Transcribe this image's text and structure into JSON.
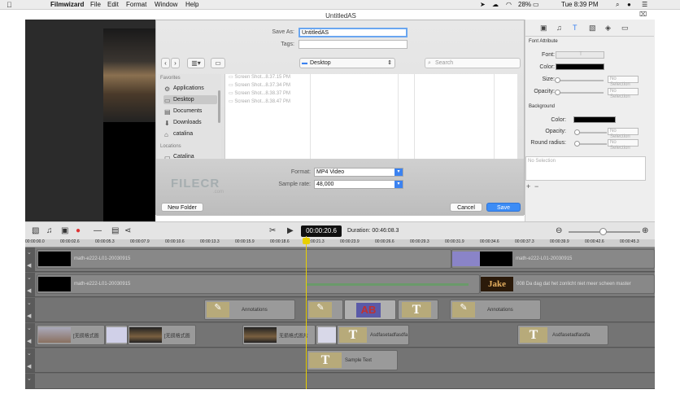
{
  "menubar": {
    "app": "Filmwizard",
    "items": [
      "File",
      "Edit",
      "Format",
      "Window",
      "Help"
    ],
    "battery": "28%",
    "clock": "Tue 8:39 PM"
  },
  "dialog": {
    "title": "UntitledAS",
    "save_as_label": "Save As:",
    "save_as_value": "UntitledAS",
    "tags_label": "Tags:",
    "tags_value": "",
    "location": "Desktop",
    "search_placeholder": "Search",
    "sidebar": {
      "favorites_label": "Favorites",
      "favorites": [
        {
          "label": "Applications",
          "icon": "applications-icon"
        },
        {
          "label": "Desktop",
          "icon": "desktop-icon"
        },
        {
          "label": "Documents",
          "icon": "documents-icon"
        },
        {
          "label": "Downloads",
          "icon": "downloads-icon"
        },
        {
          "label": "catalina",
          "icon": "home-icon"
        }
      ],
      "locations_label": "Locations",
      "locations": [
        {
          "label": "Catalina",
          "icon": "disk-icon"
        }
      ]
    },
    "files": [
      "Screen Shot...8.37.15 PM",
      "Screen Shot...8.37.34 PM",
      "Screen Shot...8.38.37 PM",
      "Screen Shot...8.38.47 PM"
    ],
    "format_label": "Format:",
    "format_value": "MP4 Video",
    "sample_rate_label": "Sample rate:",
    "sample_rate_value": "48,000",
    "new_folder": "New Folder",
    "cancel": "Cancel",
    "save": "Save"
  },
  "watermark": {
    "text": "FILECR",
    "sub": ".com"
  },
  "inspector": {
    "font_attribute": "Font Attribute",
    "font_label": "Font:",
    "font_value": "T",
    "color_label": "Color:",
    "size_label": "Size:",
    "opacity_label": "Opacity:",
    "no_selection": "No Selection",
    "background": "Background",
    "bg_color_label": "Color:",
    "bg_opacity_label": "Opacity:",
    "round_radius_label": "Round radius:",
    "no_selection_box": "No Selection"
  },
  "toolbar": {
    "timecode": "00:00:20.6",
    "duration": "Duration: 00:46:08.3"
  },
  "ruler": [
    "00:00:00.0",
    "00:00:02.6",
    "00:00:05.3",
    "00:00:07.9",
    "00:00:10.6",
    "00:00:13.3",
    "00:00:15.9",
    "00:00:18.6",
    "00:00:21.3",
    "00:00:23.9",
    "00:00:26.6",
    "00:00:29.3",
    "00:00:31.9",
    "00:00:34.6",
    "00:00:37.3",
    "00:00:39.9",
    "00:00:42.6",
    "00:00:45.3"
  ],
  "tracks": {
    "video1": "math-e222-L01-20030915",
    "video1b": "math-e222-L01-20030915",
    "video2": "math-e222-L01-20030915",
    "video2b": "008 Da dag dat het zonlicht niet meer scheen master",
    "annotations": [
      "Annotations",
      "Annotations"
    ],
    "images": [
      "[无损格式图",
      "[无损格式图",
      "无损格式图片"
    ],
    "text_a": "Asdfasetadfasdfa",
    "text_b": "Asdfasetadfasdfa",
    "sample_text": "Sample Text",
    "ab_label": "AB",
    "jake_label": "Jake"
  }
}
